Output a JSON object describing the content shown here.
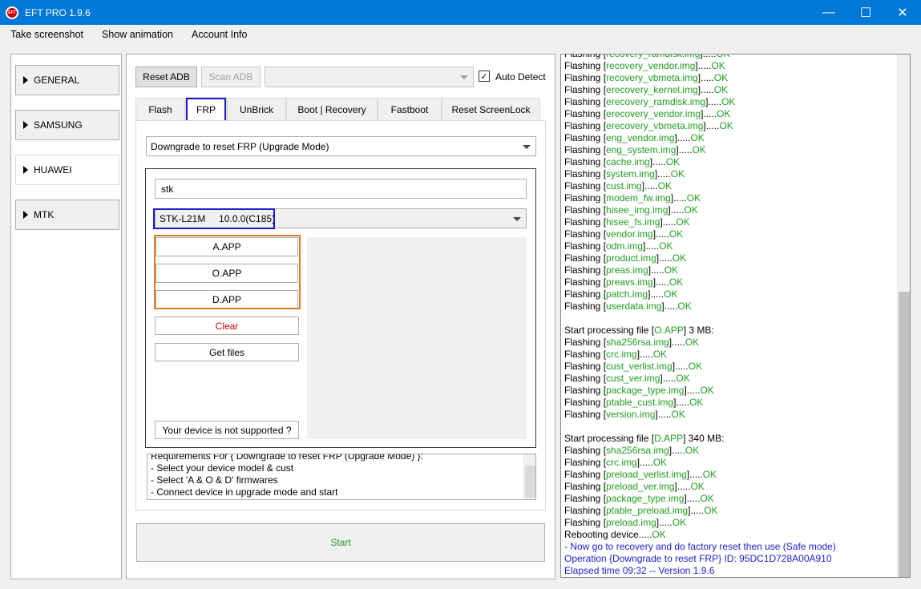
{
  "window": {
    "title": "EFT PRO 1.9.6",
    "app_icon": "EFT",
    "minimize_icon": "—",
    "maximize_icon": "☐",
    "close_icon": "✕"
  },
  "menu": [
    "Take screenshot",
    "Show animation",
    "Account Info"
  ],
  "sidebar": [
    {
      "label": "GENERAL"
    },
    {
      "label": "SAMSUNG"
    },
    {
      "label": "HUAWEI"
    },
    {
      "label": "MTK"
    }
  ],
  "toolbar": {
    "reset_adb": "Reset ADB",
    "scan_adb": "Scan ADB",
    "port_value": "",
    "auto_detect_label": "Auto Detect",
    "auto_detect_check": "✓"
  },
  "tabs": [
    "Flash",
    "FRP",
    "UnBrick",
    "Boot | Recovery",
    "Fastboot",
    "Reset ScreenLock"
  ],
  "frp": {
    "mode_value": "Downgrade to reset FRP (Upgrade Mode)",
    "search_value": "stk",
    "model_value": "STK-L21M     10.0.0(C185)",
    "a_app": "A.APP",
    "o_app": "O.APP",
    "d_app": "D.APP",
    "clear": "Clear",
    "get_files": "Get files",
    "not_supported": "Your device is not supported ?",
    "requirements": [
      "Requirements For { Downgrade to reset FRP (Upgrade Mode) }:",
      " - Select your device model & cust",
      " - Select 'A & O & D' firmwares",
      " - Connect device in upgrade mode and start"
    ],
    "start": "Start"
  },
  "colors": {
    "accent": "#0078d7",
    "ok_green": "#1e9e1e",
    "info_blue": "#1c1cd0",
    "clear_red": "#d00000",
    "highlight_blue": "#1b1bc7",
    "highlight_orange": "#e2781f"
  },
  "log": [
    {
      "pre": "Flashing [",
      "item": "recovery_ramdisk.img",
      "mid": "].....",
      "status": "OK"
    },
    {
      "pre": "Flashing [",
      "item": "recovery_vendor.img",
      "mid": "].....",
      "status": "OK"
    },
    {
      "pre": "Flashing [",
      "item": "recovery_vbmeta.img",
      "mid": "].....",
      "status": "OK"
    },
    {
      "pre": "Flashing [",
      "item": "erecovery_kernel.img",
      "mid": "].....",
      "status": "OK"
    },
    {
      "pre": "Flashing [",
      "item": "erecovery_ramdisk.img",
      "mid": "].....",
      "status": "OK"
    },
    {
      "pre": "Flashing [",
      "item": "erecovery_vendor.img",
      "mid": "].....",
      "status": "OK"
    },
    {
      "pre": "Flashing [",
      "item": "erecovery_vbmeta.img",
      "mid": "].....",
      "status": "OK"
    },
    {
      "pre": "Flashing [",
      "item": "eng_vendor.img",
      "mid": "].....",
      "status": "OK"
    },
    {
      "pre": "Flashing [",
      "item": "eng_system.img",
      "mid": "].....",
      "status": "OK"
    },
    {
      "pre": "Flashing [",
      "item": "cache.img",
      "mid": "].....",
      "status": "OK"
    },
    {
      "pre": "Flashing [",
      "item": "system.img",
      "mid": "].....",
      "status": "OK"
    },
    {
      "pre": "Flashing [",
      "item": "cust.img",
      "mid": "].....",
      "status": "OK"
    },
    {
      "pre": "Flashing [",
      "item": "modem_fw.img",
      "mid": "].....",
      "status": "OK"
    },
    {
      "pre": "Flashing [",
      "item": "hisee_img.img",
      "mid": "].....",
      "status": "OK"
    },
    {
      "pre": "Flashing [",
      "item": "hisee_fs.img",
      "mid": "].....",
      "status": "OK"
    },
    {
      "pre": "Flashing [",
      "item": "vendor.img",
      "mid": "].....",
      "status": "OK"
    },
    {
      "pre": "Flashing [",
      "item": "odm.img",
      "mid": "].....",
      "status": "OK"
    },
    {
      "pre": "Flashing [",
      "item": "product.img",
      "mid": "].....",
      "status": "OK"
    },
    {
      "pre": "Flashing [",
      "item": "preas.img",
      "mid": "].....",
      "status": "OK"
    },
    {
      "pre": "Flashing [",
      "item": "preavs.img",
      "mid": "].....",
      "status": "OK"
    },
    {
      "pre": "Flashing [",
      "item": "patch.img",
      "mid": "].....",
      "status": "OK"
    },
    {
      "pre": "Flashing [",
      "item": "userdata.img",
      "mid": "].....",
      "status": "OK"
    },
    {
      "blank": true
    },
    {
      "pre": "Start processing file [",
      "item": "O.APP",
      "mid": "] 3 MB:",
      "status": ""
    },
    {
      "pre": "Flashing [",
      "item": "sha256rsa.img",
      "mid": "].....",
      "status": "OK"
    },
    {
      "pre": "Flashing [",
      "item": "crc.img",
      "mid": "].....",
      "status": "OK"
    },
    {
      "pre": "Flashing [",
      "item": "cust_verlist.img",
      "mid": "].....",
      "status": "OK"
    },
    {
      "pre": "Flashing [",
      "item": "cust_ver.img",
      "mid": "].....",
      "status": "OK"
    },
    {
      "pre": "Flashing [",
      "item": "package_type.img",
      "mid": "].....",
      "status": "OK"
    },
    {
      "pre": "Flashing [",
      "item": "ptable_cust.img",
      "mid": "].....",
      "status": "OK"
    },
    {
      "pre": "Flashing [",
      "item": "version.img",
      "mid": "].....",
      "status": "OK"
    },
    {
      "blank": true
    },
    {
      "pre": "Start processing file [",
      "item": "D.APP",
      "mid": "] 340 MB:",
      "status": ""
    },
    {
      "pre": "Flashing [",
      "item": "sha256rsa.img",
      "mid": "].....",
      "status": "OK"
    },
    {
      "pre": "Flashing [",
      "item": "crc.img",
      "mid": "].....",
      "status": "OK"
    },
    {
      "pre": "Flashing [",
      "item": "preload_verlist.img",
      "mid": "].....",
      "status": "OK"
    },
    {
      "pre": "Flashing [",
      "item": "preload_ver.img",
      "mid": "].....",
      "status": "OK"
    },
    {
      "pre": "Flashing [",
      "item": "package_type.img",
      "mid": "].....",
      "status": "OK"
    },
    {
      "pre": "Flashing [",
      "item": "ptable_preload.img",
      "mid": "].....",
      "status": "OK"
    },
    {
      "pre": "Flashing [",
      "item": "preload.img",
      "mid": "].....",
      "status": "OK"
    },
    {
      "pre": "Rebooting device.....",
      "item": "",
      "mid": "",
      "status": "OK"
    },
    {
      "info": " - Now go to recovery and do factory reset then use (Safe mode)"
    },
    {
      "info": "Operation {Downgrade to reset FRP} ID: 95DC1D728A00A910"
    },
    {
      "info": "Elapsed time 09:32 -- Version 1.9.6"
    }
  ]
}
